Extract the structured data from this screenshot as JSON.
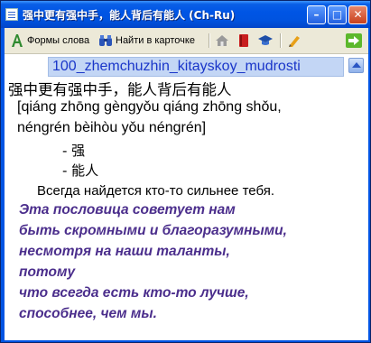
{
  "window": {
    "title": "强中更有强中手，能人背后有能人 (Ch-Ru)"
  },
  "title_buttons": {
    "minimize": "–",
    "maximize": "□",
    "close": "✕"
  },
  "toolbar": {
    "word_forms": "Формы слова",
    "find_in_card": "Найти в карточке"
  },
  "icons": [
    "word-forms-icon",
    "binoculars-icon",
    "home-icon",
    "book-icon",
    "graduation-cap-icon",
    "pen-icon",
    "forward-arrow-icon"
  ],
  "card": {
    "link": "100_zhemchuzhin_kitayskoy_mudrosti",
    "headword": "强中更有强中手，能人背后有能人",
    "pinyin_line1": "[qiáng zhōng gèngyǒu qiáng zhōng shǒu,",
    "pinyin_line2": "néngrén bèihòu yǒu néngrén]",
    "component1": "- 强",
    "component2": "- 能人",
    "translation": "Всегда найдется кто-то сильнее тебя.",
    "comment_lines": [
      "Эта пословица советует нам",
      "быть скромными и благоразумными,",
      "несмотря на наши таланты,",
      "потому",
      "что всегда есть кто-то лучше,",
      "способнее, чем мы."
    ]
  }
}
